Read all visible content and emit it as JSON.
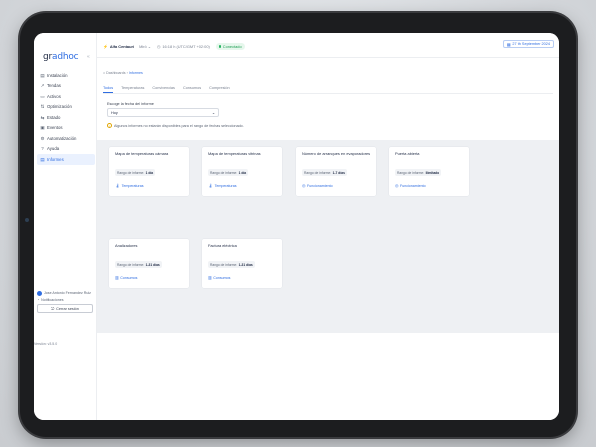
{
  "sidebar": {
    "logo": {
      "part1": "gr",
      "part2": "adhoc"
    },
    "items": [
      {
        "icon": "installation-icon",
        "glyph": "▤",
        "label": "Instalación"
      },
      {
        "icon": "trends-icon",
        "glyph": "↗",
        "label": "Tendas"
      },
      {
        "icon": "assets-icon",
        "glyph": "▭",
        "label": "Activos"
      },
      {
        "icon": "optimization-icon",
        "glyph": "⇅",
        "label": "Optimización"
      },
      {
        "icon": "status-icon",
        "glyph": "⇆",
        "label": "Estado"
      },
      {
        "icon": "events-icon",
        "glyph": "▣",
        "label": "Eventos"
      },
      {
        "icon": "automation-icon",
        "glyph": "⚙",
        "label": "Automatización"
      },
      {
        "icon": "help-icon",
        "glyph": "?",
        "label": "Ayuda"
      },
      {
        "icon": "reports-icon",
        "glyph": "▤",
        "label": "Informes"
      }
    ],
    "footer": {
      "user": "Jose Antonio Fernandez Ruiz",
      "notifications": "Notificaciones",
      "logout": "Cerrar sesión",
      "version": "Versión: v3.5.0"
    }
  },
  "topbar": {
    "org": "Alfa Centauri",
    "site": "Mirô ⌄",
    "timezone": "16:18 h (UTC/GMT +02:00)",
    "connection": "Conectado",
    "date": "27 th September 2024"
  },
  "content": {
    "breadcrumb": {
      "home": "Dashboards",
      "sep": "›",
      "current": "Informes"
    },
    "tabs": [
      "Todos",
      "Temperaturas",
      "Convivencias",
      "Consumos",
      "Compresión"
    ],
    "date_range_label": "Escoge la fecha del informe",
    "date_range_value": "Hoy",
    "note": "Algunos informes no estarán disponibles para el rango de fechas seleccionado.",
    "cards": [
      {
        "title": "Mapa de temperaturas cámara",
        "range_label": "Rango de informe:",
        "range_value": "1 día",
        "section": "Temperaturas"
      },
      {
        "title": "Mapa de temperaturas vitrinas",
        "range_label": "Rango de informe:",
        "range_value": "1 día",
        "section": "Temperaturas"
      },
      {
        "title": "Número de arranques en evaporadores",
        "range_label": "Rango de informe:",
        "range_value": "1-7 días",
        "section": "Funcionamiento"
      },
      {
        "title": "Puerta abierta",
        "range_label": "Rango de informe:",
        "range_value": "Ilimitado",
        "section": "Funcionamiento"
      },
      {
        "title": "Analizadores",
        "range_label": "Rango de informe:",
        "range_value": "1-31 días",
        "section": "Consumos"
      },
      {
        "title": "Factura eléctrica",
        "range_label": "Rango de informe:",
        "range_value": "1-31 días",
        "section": "Consumos"
      }
    ]
  }
}
